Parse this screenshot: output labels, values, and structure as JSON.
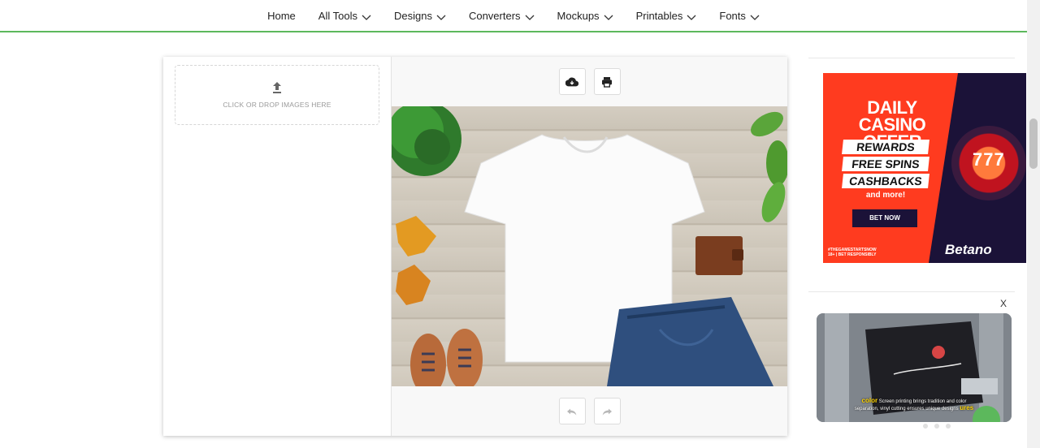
{
  "nav": {
    "items": [
      {
        "label": "Home",
        "has_dropdown": false
      },
      {
        "label": "All Tools",
        "has_dropdown": true
      },
      {
        "label": "Designs",
        "has_dropdown": true
      },
      {
        "label": "Converters",
        "has_dropdown": true
      },
      {
        "label": "Mockups",
        "has_dropdown": true
      },
      {
        "label": "Printables",
        "has_dropdown": true
      },
      {
        "label": "Fonts",
        "has_dropdown": true
      }
    ],
    "accent_color": "#5cb85c"
  },
  "editor": {
    "dropzone_text": "CLICK OR DROP IMAGES HERE",
    "toolbar_top": [
      "cloud-download-icon",
      "print-icon"
    ],
    "toolbar_bottom": [
      "undo-icon",
      "redo-icon"
    ]
  },
  "ad": {
    "title_line1": "DAILY",
    "title_line2": "CASINO OFFER",
    "chips": [
      "REWARDS",
      "FREE SPINS",
      "CASHBACKS"
    ],
    "more": "and more!",
    "cta": "BET NOW",
    "footer_line1": "#THEGAMESTARTSNOW",
    "footer_line2": "18+ | BET RESPONSIBLY",
    "brand": "Betano",
    "slot_number": "777"
  },
  "video": {
    "close_label": "X",
    "caption_left": "color",
    "caption_main_1": "Screen printing brings tradition and color",
    "caption_main_2": "separation, vinyl cutting ensures unique designs",
    "caption_right": "ures"
  }
}
